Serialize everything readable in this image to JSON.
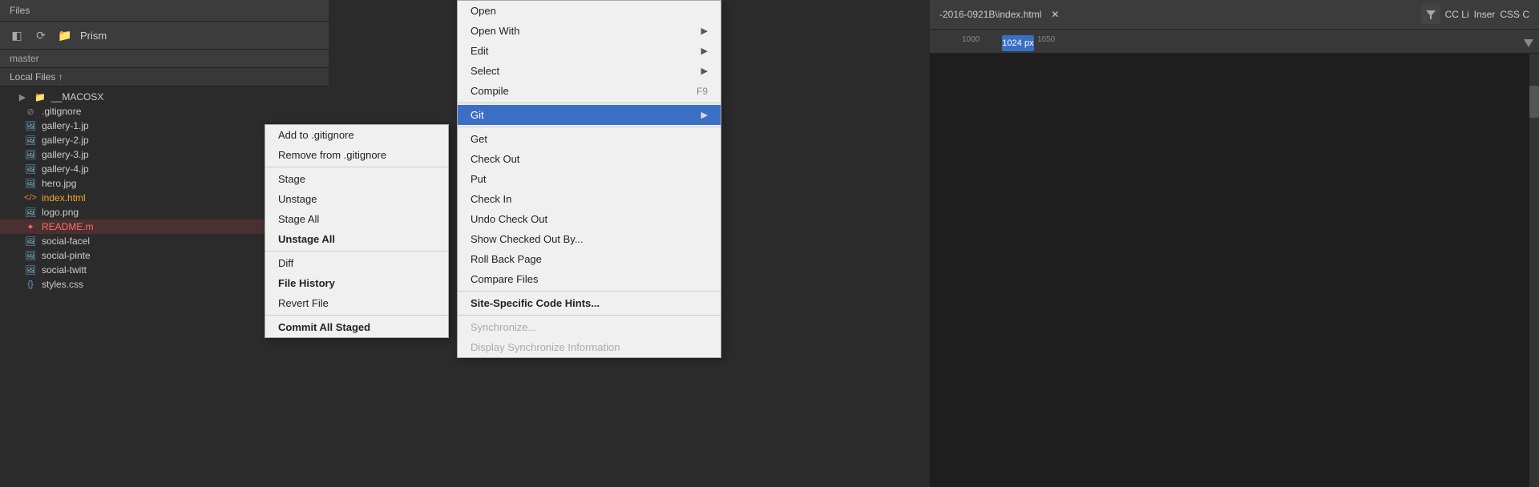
{
  "filesPanel": {
    "header": "Files",
    "toolbar": {
      "icon1": "◧",
      "icon2": "⟳",
      "folderIcon": "📁",
      "siteLabel": "Prism"
    },
    "master": "master",
    "localFiles": "Local Files ↑",
    "tree": [
      {
        "type": "folder",
        "name": "__MACOSX",
        "indent": 1
      },
      {
        "type": "file",
        "name": ".gitignore",
        "icon": "git",
        "indent": 2
      },
      {
        "type": "file",
        "name": "gallery-1.jp",
        "icon": "image",
        "indent": 2
      },
      {
        "type": "file",
        "name": "gallery-2.jp",
        "icon": "image",
        "indent": 2
      },
      {
        "type": "file",
        "name": "gallery-3.jp",
        "icon": "image",
        "indent": 2
      },
      {
        "type": "file",
        "name": "gallery-4.jp",
        "icon": "image",
        "indent": 2
      },
      {
        "type": "file",
        "name": "hero.jpg",
        "icon": "image",
        "indent": 2
      },
      {
        "type": "file",
        "name": "index.html",
        "icon": "html",
        "indent": 2,
        "special": "orange"
      },
      {
        "type": "file",
        "name": "logo.png",
        "icon": "image",
        "indent": 2
      },
      {
        "type": "file",
        "name": "README.m",
        "icon": "readme",
        "indent": 2,
        "special": "readme"
      },
      {
        "type": "file",
        "name": "social-facel",
        "icon": "image",
        "indent": 2
      },
      {
        "type": "file",
        "name": "social-pinte",
        "icon": "image",
        "indent": 2
      },
      {
        "type": "file",
        "name": "social-twitt",
        "icon": "image",
        "indent": 2
      },
      {
        "type": "file",
        "name": "styles.css",
        "icon": "css",
        "indent": 2
      }
    ]
  },
  "rightPanel": {
    "header": "-2016-0921B\\index.html",
    "ruler": {
      "marks": [
        "1000",
        "1050"
      ]
    },
    "ccItems": [
      "CC Li",
      "Inser",
      "CSS C"
    ]
  },
  "contextMenu": {
    "items": [
      {
        "id": "open",
        "label": "Open",
        "type": "normal"
      },
      {
        "id": "open-with",
        "label": "Open With",
        "type": "submenu"
      },
      {
        "id": "edit",
        "label": "Edit",
        "type": "submenu"
      },
      {
        "id": "select",
        "label": "Select",
        "type": "submenu"
      },
      {
        "id": "compile",
        "label": "Compile",
        "shortcut": "F9",
        "type": "normal"
      },
      {
        "id": "git",
        "label": "Git",
        "type": "highlighted-submenu"
      },
      {
        "id": "get",
        "label": "Get",
        "type": "normal"
      },
      {
        "id": "check-out",
        "label": "Check Out",
        "type": "normal"
      },
      {
        "id": "put",
        "label": "Put",
        "type": "normal"
      },
      {
        "id": "check-in",
        "label": "Check In",
        "type": "normal"
      },
      {
        "id": "undo-check-out",
        "label": "Undo Check Out",
        "type": "normal"
      },
      {
        "id": "show-checked-out-by",
        "label": "Show Checked Out By...",
        "type": "normal"
      },
      {
        "id": "roll-back-page",
        "label": "Roll Back Page",
        "type": "normal"
      },
      {
        "id": "compare-files",
        "label": "Compare Files",
        "type": "normal"
      },
      {
        "id": "site-specific-code-hints",
        "label": "Site-Specific Code Hints...",
        "type": "bold"
      },
      {
        "id": "synchronize",
        "label": "Synchronize...",
        "type": "disabled"
      },
      {
        "id": "display-synchronize-info",
        "label": "Display Synchronize Information",
        "type": "disabled"
      }
    ]
  },
  "submenu": {
    "items": [
      {
        "id": "add-to-gitignore",
        "label": "Add to .gitignore",
        "type": "normal"
      },
      {
        "id": "remove-from-gitignore",
        "label": "Remove from .gitignore",
        "type": "normal"
      },
      {
        "id": "stage",
        "label": "Stage",
        "type": "normal"
      },
      {
        "id": "unstage",
        "label": "Unstage",
        "type": "normal"
      },
      {
        "id": "stage-all",
        "label": "Stage All",
        "type": "normal"
      },
      {
        "id": "unstage-all",
        "label": "Unstage All",
        "type": "bold"
      },
      {
        "id": "diff",
        "label": "Diff",
        "type": "normal"
      },
      {
        "id": "file-history",
        "label": "File History",
        "type": "bold"
      },
      {
        "id": "revert-file",
        "label": "Revert File",
        "type": "normal"
      },
      {
        "id": "commit-all-staged",
        "label": "Commit All Staged",
        "type": "bold"
      }
    ]
  }
}
